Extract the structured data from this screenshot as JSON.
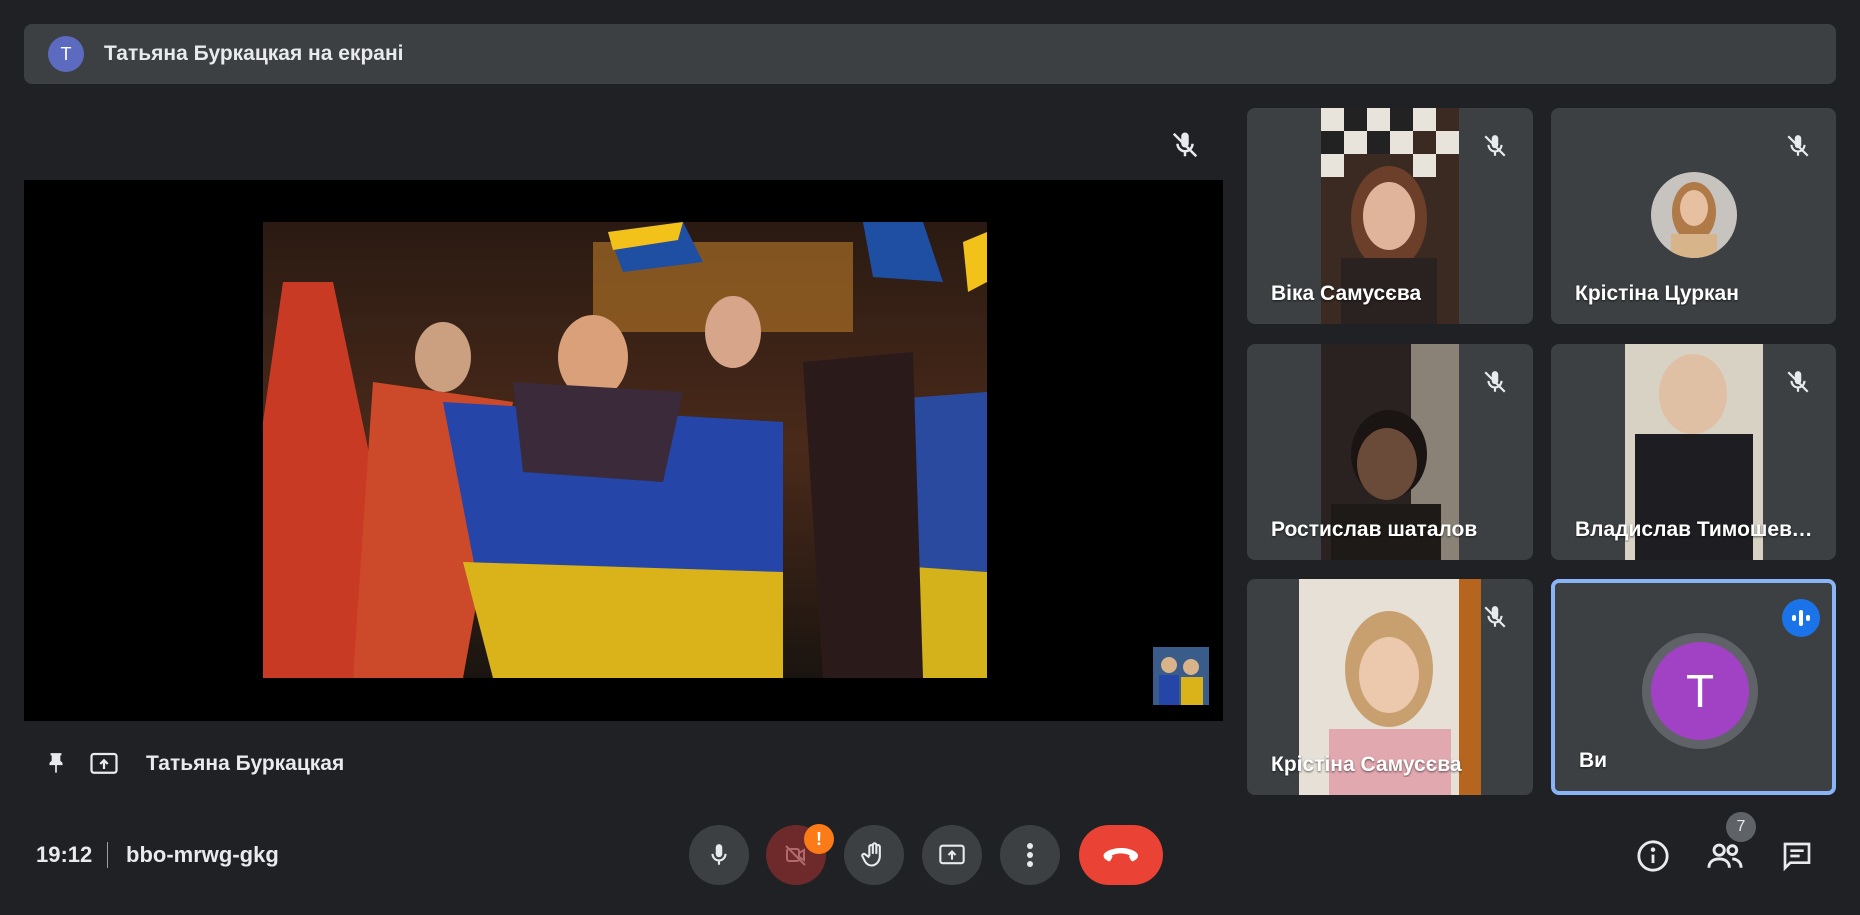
{
  "banner": {
    "avatar_letter": "Т",
    "text": "Татьяна Буркацкая на екрані"
  },
  "presenter": {
    "name": "Татьяна Буркацкая"
  },
  "participants": [
    {
      "name": "Віка Самусєва",
      "muted": true
    },
    {
      "name": "Крістіна Цуркан",
      "muted": true
    },
    {
      "name": "Ростислав шаталов",
      "muted": true
    },
    {
      "name": "Владислав Тимошевський",
      "muted": true
    },
    {
      "name": "Крістіна Самусєва",
      "muted": true
    },
    {
      "name": "Ви",
      "avatar_letter": "T",
      "speaking": true
    }
  ],
  "meeting": {
    "time": "19:12",
    "code": "bbo-mrwg-gkg"
  },
  "controls": {
    "camera_alert": "!",
    "participant_count": "7"
  },
  "colors": {
    "background": "#202124",
    "tile": "#3c4043",
    "end_call": "#ea4335",
    "active_border": "#8ab4f8",
    "avatar_purple": "#a142c4",
    "speaking_blue": "#1a73e8",
    "alert_orange": "#fa7b17"
  }
}
